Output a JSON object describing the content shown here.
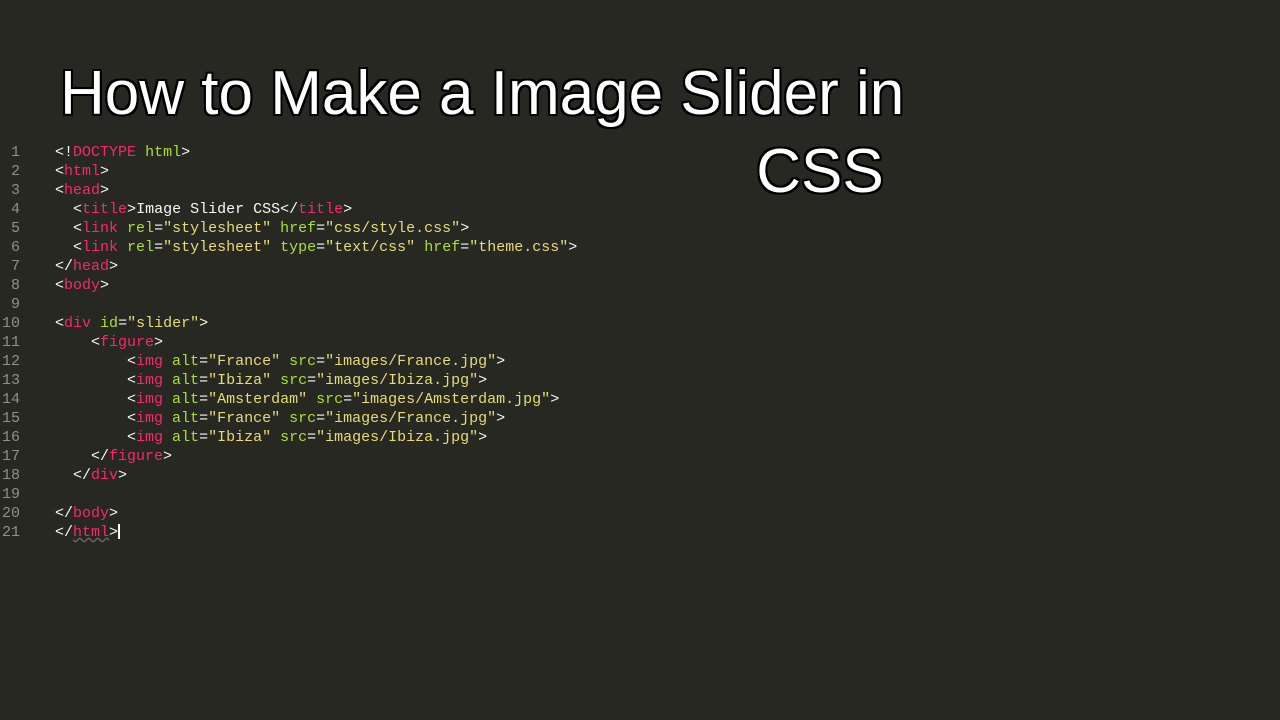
{
  "title": {
    "line1": "How to Make a Image Slider in",
    "line2": "CSS"
  },
  "line_numbers": [
    "1",
    "2",
    "3",
    "4",
    "5",
    "6",
    "7",
    "8",
    "9",
    "10",
    "11",
    "12",
    "13",
    "14",
    "15",
    "16",
    "17",
    "18",
    "19",
    "20",
    "21"
  ],
  "code": [
    [
      {
        "cls": "p-brk",
        "t": "<!"
      },
      {
        "cls": "p-tag",
        "t": "DOCTYPE"
      },
      {
        "cls": "p-brk",
        "t": " "
      },
      {
        "cls": "p-attr",
        "t": "html"
      },
      {
        "cls": "p-brk",
        "t": ">"
      }
    ],
    [
      {
        "cls": "p-brk",
        "t": "<"
      },
      {
        "cls": "p-tag",
        "t": "html"
      },
      {
        "cls": "p-brk",
        "t": ">"
      }
    ],
    [
      {
        "cls": "p-brk",
        "t": "<"
      },
      {
        "cls": "p-tag",
        "t": "head"
      },
      {
        "cls": "p-brk",
        "t": ">"
      }
    ],
    [
      {
        "cls": "p-brk",
        "t": "  <"
      },
      {
        "cls": "p-tag",
        "t": "title"
      },
      {
        "cls": "p-brk",
        "t": ">"
      },
      {
        "cls": "p-txt",
        "t": "Image Slider CSS"
      },
      {
        "cls": "p-brk",
        "t": "</"
      },
      {
        "cls": "p-tag",
        "t": "title"
      },
      {
        "cls": "p-brk",
        "t": ">"
      }
    ],
    [
      {
        "cls": "p-brk",
        "t": "  <"
      },
      {
        "cls": "p-tag",
        "t": "link "
      },
      {
        "cls": "p-attr",
        "t": "rel"
      },
      {
        "cls": "p-brk",
        "t": "="
      },
      {
        "cls": "p-str",
        "t": "\"stylesheet\""
      },
      {
        "cls": "p-brk",
        "t": " "
      },
      {
        "cls": "p-attr",
        "t": "href"
      },
      {
        "cls": "p-brk",
        "t": "="
      },
      {
        "cls": "p-str",
        "t": "\"css/style.css\""
      },
      {
        "cls": "p-brk",
        "t": ">"
      }
    ],
    [
      {
        "cls": "p-brk",
        "t": "  <"
      },
      {
        "cls": "p-tag",
        "t": "link "
      },
      {
        "cls": "p-attr",
        "t": "rel"
      },
      {
        "cls": "p-brk",
        "t": "="
      },
      {
        "cls": "p-str",
        "t": "\"stylesheet\""
      },
      {
        "cls": "p-brk",
        "t": " "
      },
      {
        "cls": "p-attr",
        "t": "type"
      },
      {
        "cls": "p-brk",
        "t": "="
      },
      {
        "cls": "p-str",
        "t": "\"text/css\""
      },
      {
        "cls": "p-brk",
        "t": " "
      },
      {
        "cls": "p-attr",
        "t": "href"
      },
      {
        "cls": "p-brk",
        "t": "="
      },
      {
        "cls": "p-str",
        "t": "\"theme.css\""
      },
      {
        "cls": "p-brk",
        "t": ">"
      }
    ],
    [
      {
        "cls": "p-brk",
        "t": "</"
      },
      {
        "cls": "p-tag",
        "t": "head"
      },
      {
        "cls": "p-brk",
        "t": ">"
      }
    ],
    [
      {
        "cls": "p-brk",
        "t": "<"
      },
      {
        "cls": "p-tag",
        "t": "body"
      },
      {
        "cls": "p-brk",
        "t": ">"
      }
    ],
    [],
    [
      {
        "cls": "p-brk",
        "t": "<"
      },
      {
        "cls": "p-tag",
        "t": "div "
      },
      {
        "cls": "p-attr",
        "t": "id"
      },
      {
        "cls": "p-brk",
        "t": "="
      },
      {
        "cls": "p-str",
        "t": "\"slider\""
      },
      {
        "cls": "p-brk",
        "t": ">"
      }
    ],
    [
      {
        "cls": "p-brk",
        "t": "    <"
      },
      {
        "cls": "p-tag",
        "t": "figure"
      },
      {
        "cls": "p-brk",
        "t": ">"
      }
    ],
    [
      {
        "cls": "p-brk",
        "t": "        <"
      },
      {
        "cls": "p-tag",
        "t": "img "
      },
      {
        "cls": "p-attr",
        "t": "alt"
      },
      {
        "cls": "p-brk",
        "t": "="
      },
      {
        "cls": "p-str",
        "t": "\"France\""
      },
      {
        "cls": "p-brk",
        "t": " "
      },
      {
        "cls": "p-attr",
        "t": "src"
      },
      {
        "cls": "p-brk",
        "t": "="
      },
      {
        "cls": "p-str",
        "t": "\"images/France.jpg\""
      },
      {
        "cls": "p-brk",
        "t": ">"
      }
    ],
    [
      {
        "cls": "p-brk",
        "t": "        <"
      },
      {
        "cls": "p-tag",
        "t": "img "
      },
      {
        "cls": "p-attr",
        "t": "alt"
      },
      {
        "cls": "p-brk",
        "t": "="
      },
      {
        "cls": "p-str",
        "t": "\"Ibiza\""
      },
      {
        "cls": "p-brk",
        "t": " "
      },
      {
        "cls": "p-attr",
        "t": "src"
      },
      {
        "cls": "p-brk",
        "t": "="
      },
      {
        "cls": "p-str",
        "t": "\"images/Ibiza.jpg\""
      },
      {
        "cls": "p-brk",
        "t": ">"
      }
    ],
    [
      {
        "cls": "p-brk",
        "t": "        <"
      },
      {
        "cls": "p-tag",
        "t": "img "
      },
      {
        "cls": "p-attr",
        "t": "alt"
      },
      {
        "cls": "p-brk",
        "t": "="
      },
      {
        "cls": "p-str",
        "t": "\"Amsterdam\""
      },
      {
        "cls": "p-brk",
        "t": " "
      },
      {
        "cls": "p-attr",
        "t": "src"
      },
      {
        "cls": "p-brk",
        "t": "="
      },
      {
        "cls": "p-str",
        "t": "\"images/Amsterdam.jpg\""
      },
      {
        "cls": "p-brk",
        "t": ">"
      }
    ],
    [
      {
        "cls": "p-brk",
        "t": "        <"
      },
      {
        "cls": "p-tag",
        "t": "img "
      },
      {
        "cls": "p-attr",
        "t": "alt"
      },
      {
        "cls": "p-brk",
        "t": "="
      },
      {
        "cls": "p-str",
        "t": "\"France\""
      },
      {
        "cls": "p-brk",
        "t": " "
      },
      {
        "cls": "p-attr",
        "t": "src"
      },
      {
        "cls": "p-brk",
        "t": "="
      },
      {
        "cls": "p-str",
        "t": "\"images/France.jpg\""
      },
      {
        "cls": "p-brk",
        "t": ">"
      }
    ],
    [
      {
        "cls": "p-brk",
        "t": "        <"
      },
      {
        "cls": "p-tag",
        "t": "img "
      },
      {
        "cls": "p-attr",
        "t": "alt"
      },
      {
        "cls": "p-brk",
        "t": "="
      },
      {
        "cls": "p-str",
        "t": "\"Ibiza\""
      },
      {
        "cls": "p-brk",
        "t": " "
      },
      {
        "cls": "p-attr",
        "t": "src"
      },
      {
        "cls": "p-brk",
        "t": "="
      },
      {
        "cls": "p-str",
        "t": "\"images/Ibiza.jpg\""
      },
      {
        "cls": "p-brk",
        "t": ">"
      }
    ],
    [
      {
        "cls": "p-brk",
        "t": "    </"
      },
      {
        "cls": "p-tag",
        "t": "figure"
      },
      {
        "cls": "p-brk",
        "t": ">"
      }
    ],
    [
      {
        "cls": "p-brk",
        "t": "  </"
      },
      {
        "cls": "p-tag",
        "t": "div"
      },
      {
        "cls": "p-brk",
        "t": ">"
      }
    ],
    [],
    [
      {
        "cls": "p-brk",
        "t": "</"
      },
      {
        "cls": "p-tag",
        "t": "body"
      },
      {
        "cls": "p-brk",
        "t": ">"
      }
    ],
    [
      {
        "cls": "p-brk",
        "t": "</"
      },
      {
        "cls": "p-tag underline-wavy",
        "t": "html"
      },
      {
        "cls": "p-brk",
        "t": ">"
      },
      {
        "cursor": true
      }
    ]
  ]
}
